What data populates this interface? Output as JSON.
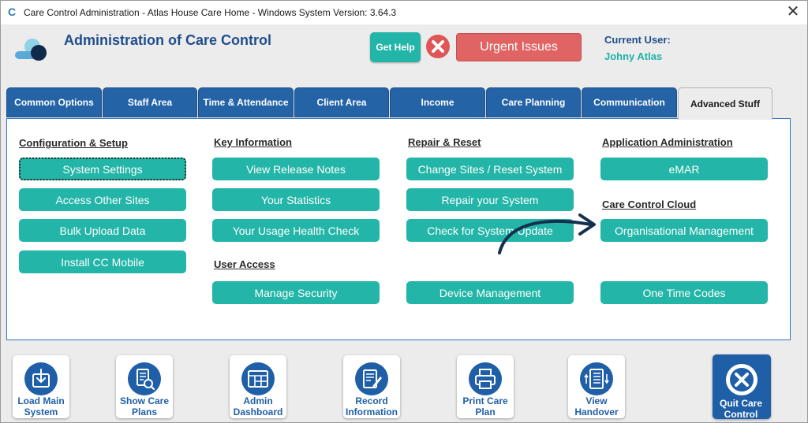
{
  "window": {
    "title": "Care Control Administration - Atlas House Care Home - Windows System Version: 3.64.3",
    "close_glyph": "✕",
    "app_icon": "C"
  },
  "header": {
    "app_title": "Administration of Care Control",
    "get_help": "Get Help",
    "urgent": "Urgent Issues",
    "current_user_label": "Current User:",
    "current_user_name": "Johny Atlas"
  },
  "tabs": [
    {
      "label": "Common Options"
    },
    {
      "label": "Staff Area"
    },
    {
      "label": "Time & Attendance"
    },
    {
      "label": "Client Area"
    },
    {
      "label": "Income"
    },
    {
      "label": "Care Planning"
    },
    {
      "label": "Communication"
    },
    {
      "label": "Advanced Stuff",
      "active": true
    }
  ],
  "sections": {
    "config": {
      "heading": "Configuration & Setup",
      "buttons": [
        "System Settings",
        "Access Other Sites",
        "Bulk Upload Data",
        "Install CC Mobile"
      ]
    },
    "key_info": {
      "heading": "Key Information",
      "buttons": [
        "View Release Notes",
        "Your Statistics",
        "Your Usage Health Check"
      ]
    },
    "user_access": {
      "heading": "User Access",
      "buttons": [
        "Manage Security"
      ]
    },
    "repair": {
      "heading": "Repair & Reset",
      "buttons": [
        "Change Sites / Reset System",
        "Repair your System",
        "Check for System Update",
        "Device Management"
      ]
    },
    "app_admin": {
      "heading": "Application Administration",
      "buttons": [
        "eMAR"
      ]
    },
    "cloud": {
      "heading": "Care Control Cloud",
      "buttons": [
        "Organisational Management",
        "One Time Codes"
      ]
    }
  },
  "bottom_nav": [
    {
      "line1": "Load Main",
      "line2": "System",
      "icon": "download-icon"
    },
    {
      "line1": "Show Care",
      "line2": "Plans",
      "icon": "document-search-icon"
    },
    {
      "line1": "Admin",
      "line2": "Dashboard",
      "icon": "dashboard-icon"
    },
    {
      "line1": "Record",
      "line2": "Information",
      "icon": "edit-document-icon"
    },
    {
      "line1": "Print Care",
      "line2": "Plan",
      "icon": "printer-icon"
    },
    {
      "line1": "View",
      "line2": "Handover",
      "icon": "handover-list-icon"
    }
  ],
  "quit": {
    "line1": "Quit Care",
    "line2": "Control",
    "icon": "close-circle-icon"
  },
  "colors": {
    "teal": "#22b5a8",
    "blue": "#2463a6",
    "urgent_red": "#e06464",
    "title_blue": "#1f4e8c"
  }
}
